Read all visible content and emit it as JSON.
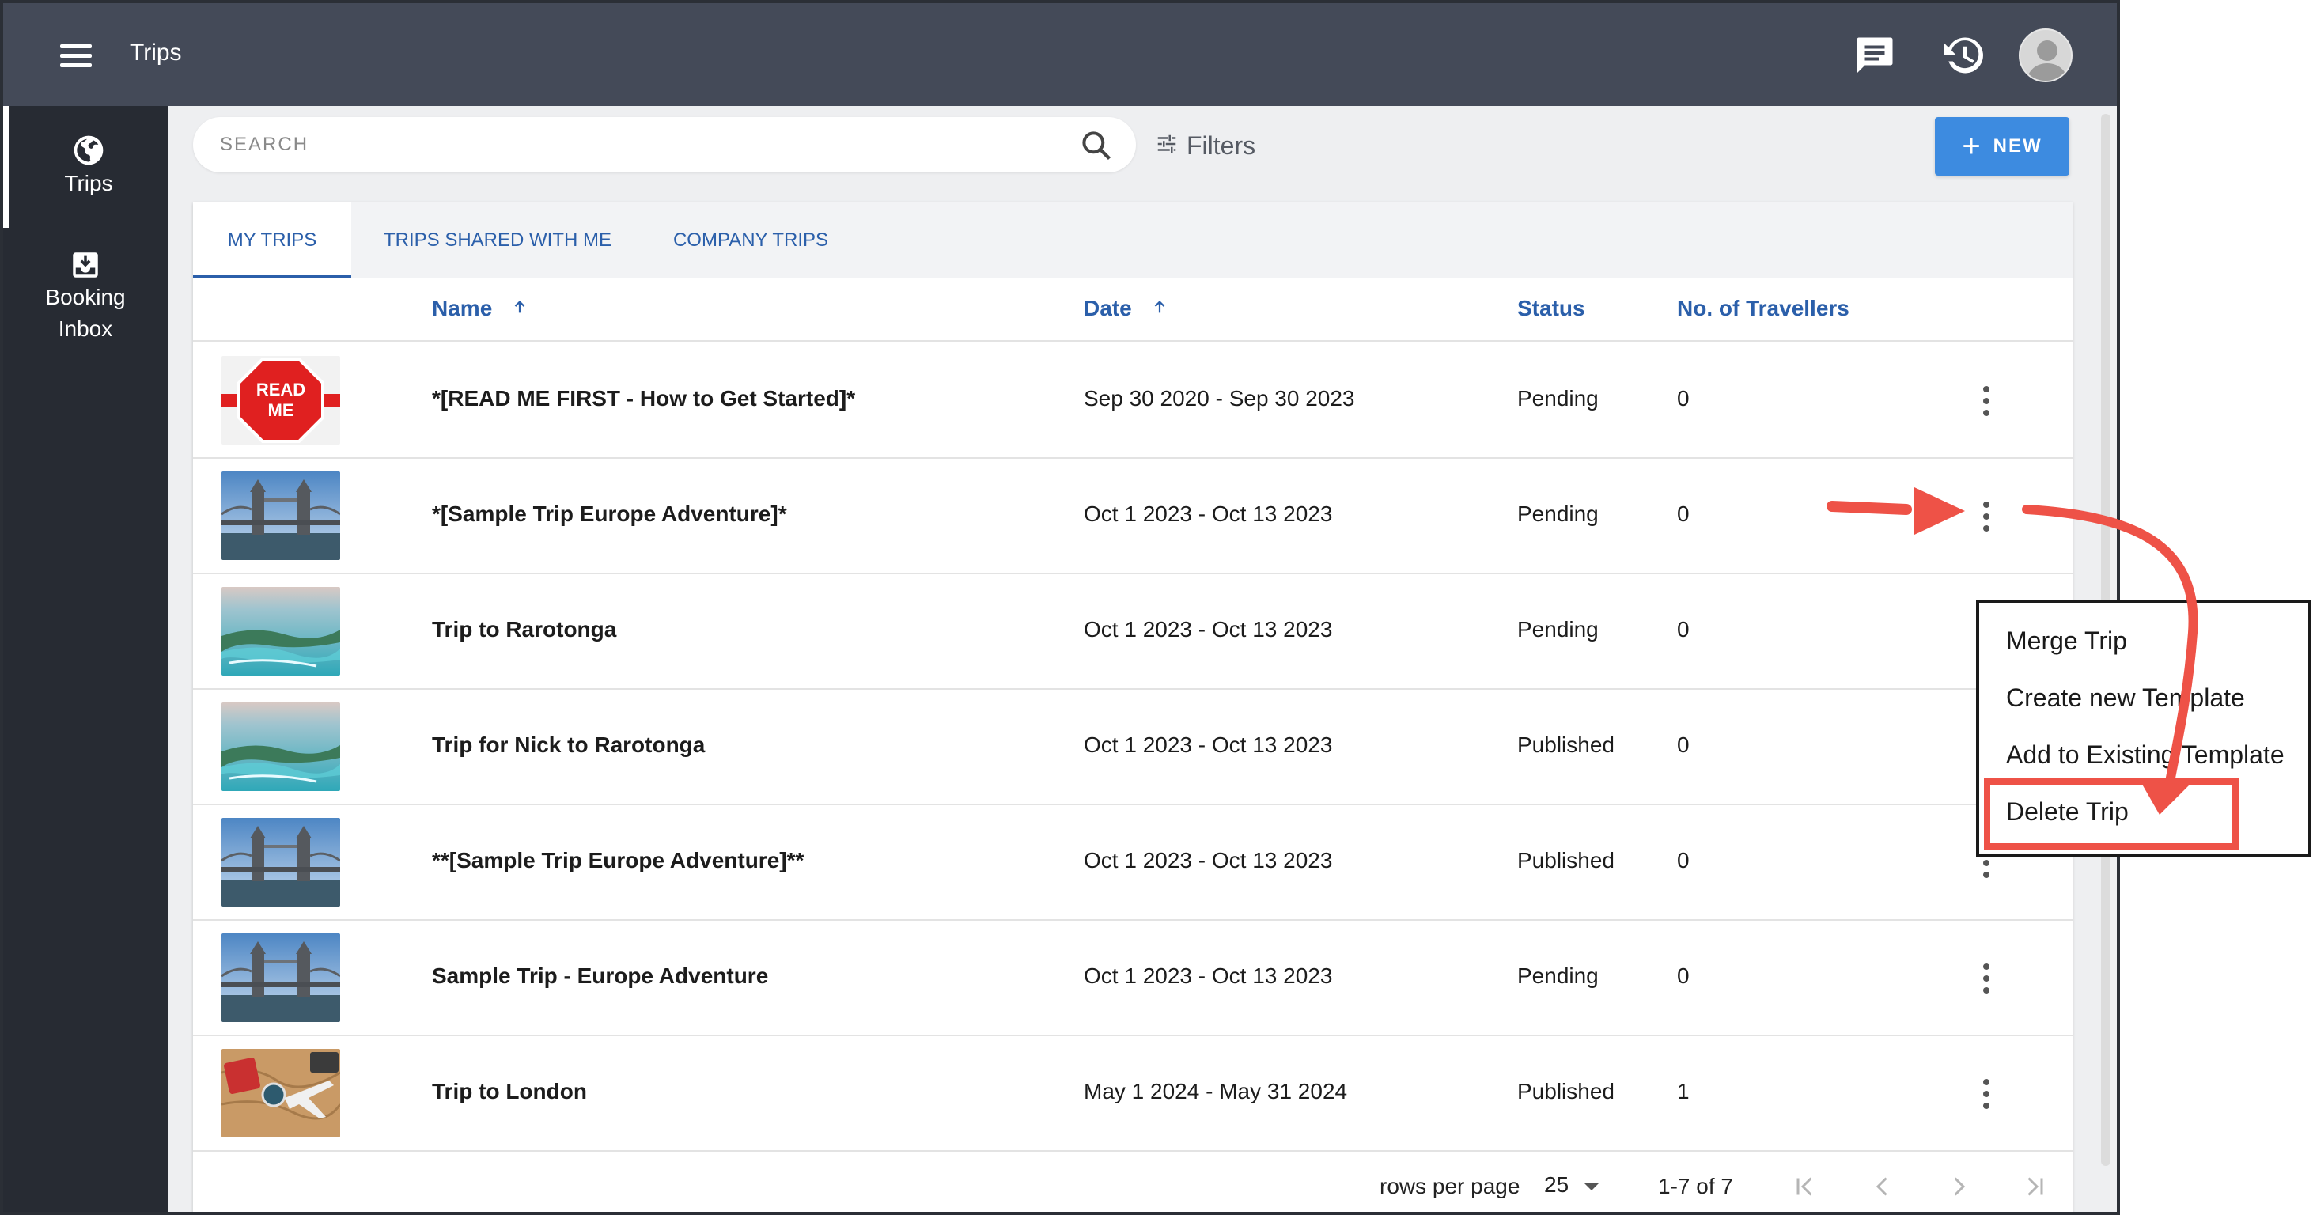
{
  "app": {
    "title": "Trips"
  },
  "sidebar": {
    "items": [
      {
        "label": "Trips",
        "icon": "globe-icon"
      },
      {
        "label_line1": "Booking",
        "label_line2": "Inbox",
        "icon": "inbox-icon"
      }
    ]
  },
  "toolbar": {
    "search_placeholder": "SEARCH",
    "filters_label": "Filters",
    "new_label": "NEW",
    "new_plus": "+"
  },
  "tabs": [
    {
      "label": "MY TRIPS",
      "active": true
    },
    {
      "label": "TRIPS SHARED WITH ME",
      "active": false
    },
    {
      "label": "COMPANY TRIPS",
      "active": false
    }
  ],
  "table": {
    "columns": {
      "name": "Name",
      "date": "Date",
      "status": "Status",
      "travellers": "No. of Travellers"
    },
    "rows": [
      {
        "name": "*[READ ME FIRST - How to Get Started]*",
        "date": "Sep 30 2020 - Sep 30 2023",
        "status": "Pending",
        "travellers": "0",
        "thumb": "read-me"
      },
      {
        "name": "*[Sample Trip Europe Adventure]*",
        "date": "Oct 1 2023 - Oct 13 2023",
        "status": "Pending",
        "travellers": "0",
        "thumb": "bridge"
      },
      {
        "name": "Trip to Rarotonga",
        "date": "Oct 1 2023 - Oct 13 2023",
        "status": "Pending",
        "travellers": "0",
        "thumb": "island"
      },
      {
        "name": "Trip for Nick to Rarotonga",
        "date": "Oct 1 2023 - Oct 13 2023",
        "status": "Published",
        "travellers": "0",
        "thumb": "island"
      },
      {
        "name": "**[Sample Trip Europe Adventure]**",
        "date": "Oct 1 2023 - Oct 13 2023",
        "status": "Published",
        "travellers": "0",
        "thumb": "bridge"
      },
      {
        "name": "Sample Trip - Europe Adventure",
        "date": "Oct 1 2023 - Oct 13 2023",
        "status": "Pending",
        "travellers": "0",
        "thumb": "bridge"
      },
      {
        "name": "Trip to London",
        "date": "May 1 2024 - May 31 2024",
        "status": "Published",
        "travellers": "1",
        "thumb": "travel-map"
      }
    ],
    "read_me_line1": "READ",
    "read_me_line2": "ME"
  },
  "pagination": {
    "rows_per_page_label": "rows per page",
    "rows_per_page_value": "25",
    "range": "1-7 of 7"
  },
  "context_menu": {
    "items": [
      "Merge Trip",
      "Create new Template",
      "Add to Existing Template",
      "Delete Trip"
    ]
  },
  "colors": {
    "topbar": "#444a58",
    "sidebar": "#272b33",
    "accent": "#2b5faa",
    "new_button": "#3d8be0",
    "annotation": "#ee5247"
  }
}
